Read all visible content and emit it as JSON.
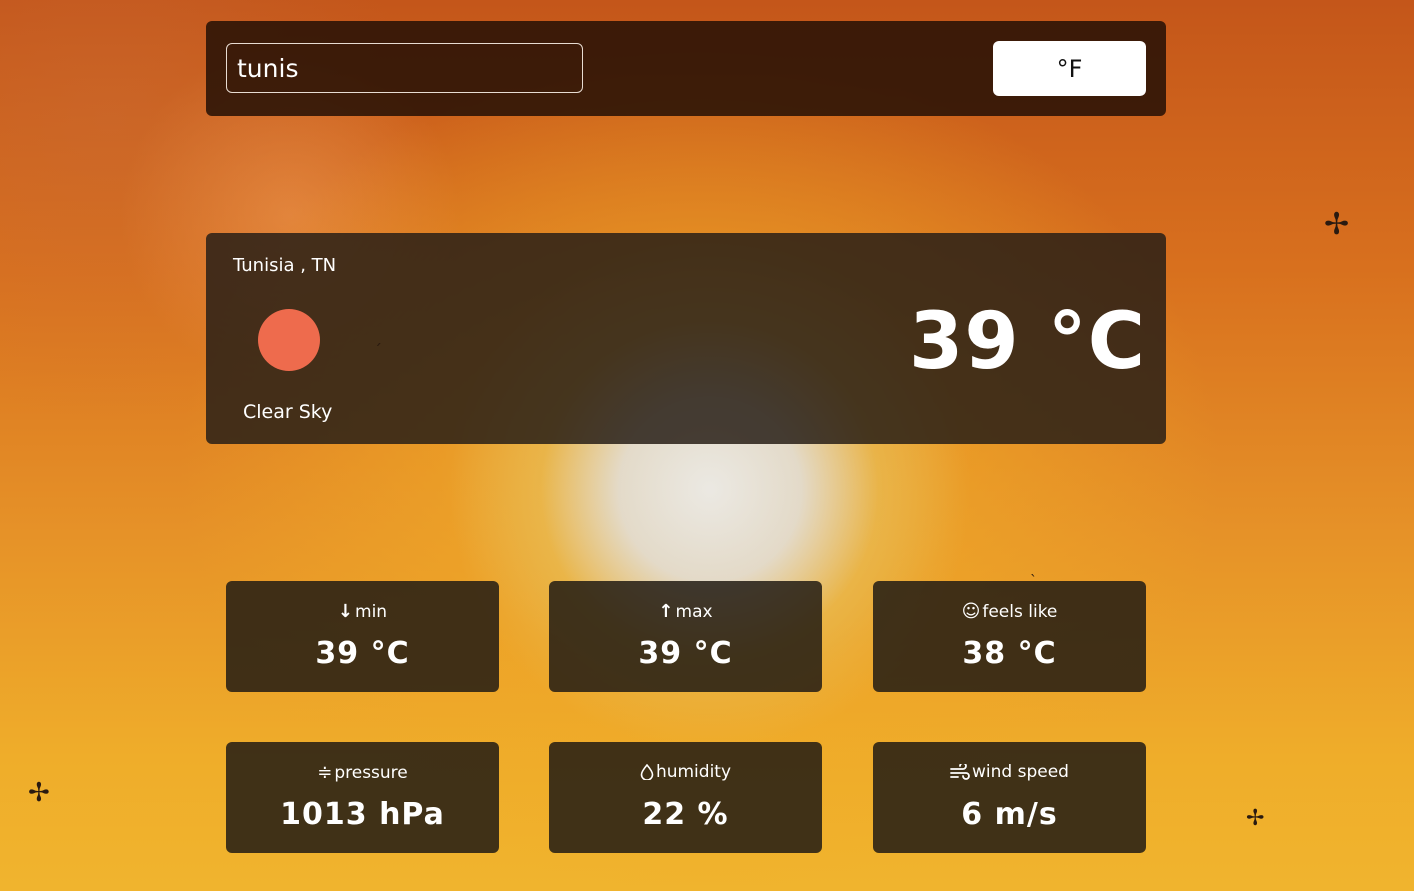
{
  "search": {
    "value": "tunis"
  },
  "unit_toggle": {
    "label": "°F"
  },
  "current": {
    "location": "Tunisia , TN",
    "condition": "Clear Sky",
    "temperature": "39 °C",
    "icon": "sun-icon",
    "icon_color": "#ee6b4d"
  },
  "stats": {
    "min": {
      "label": "min",
      "value": "39 °C",
      "icon": "arrow-down-icon"
    },
    "max": {
      "label": "max",
      "value": "39 °C",
      "icon": "arrow-up-icon"
    },
    "feels_like": {
      "label": "feels like",
      "value": "38 °C",
      "icon": "smiley-icon"
    },
    "pressure": {
      "label": "pressure",
      "value": "1013 hPa",
      "icon": "pressure-icon"
    },
    "humidity": {
      "label": "humidity",
      "value": "22 %",
      "icon": "droplet-icon"
    },
    "wind_speed": {
      "label": "wind speed",
      "value": "6 m/s",
      "icon": "wind-icon"
    }
  }
}
